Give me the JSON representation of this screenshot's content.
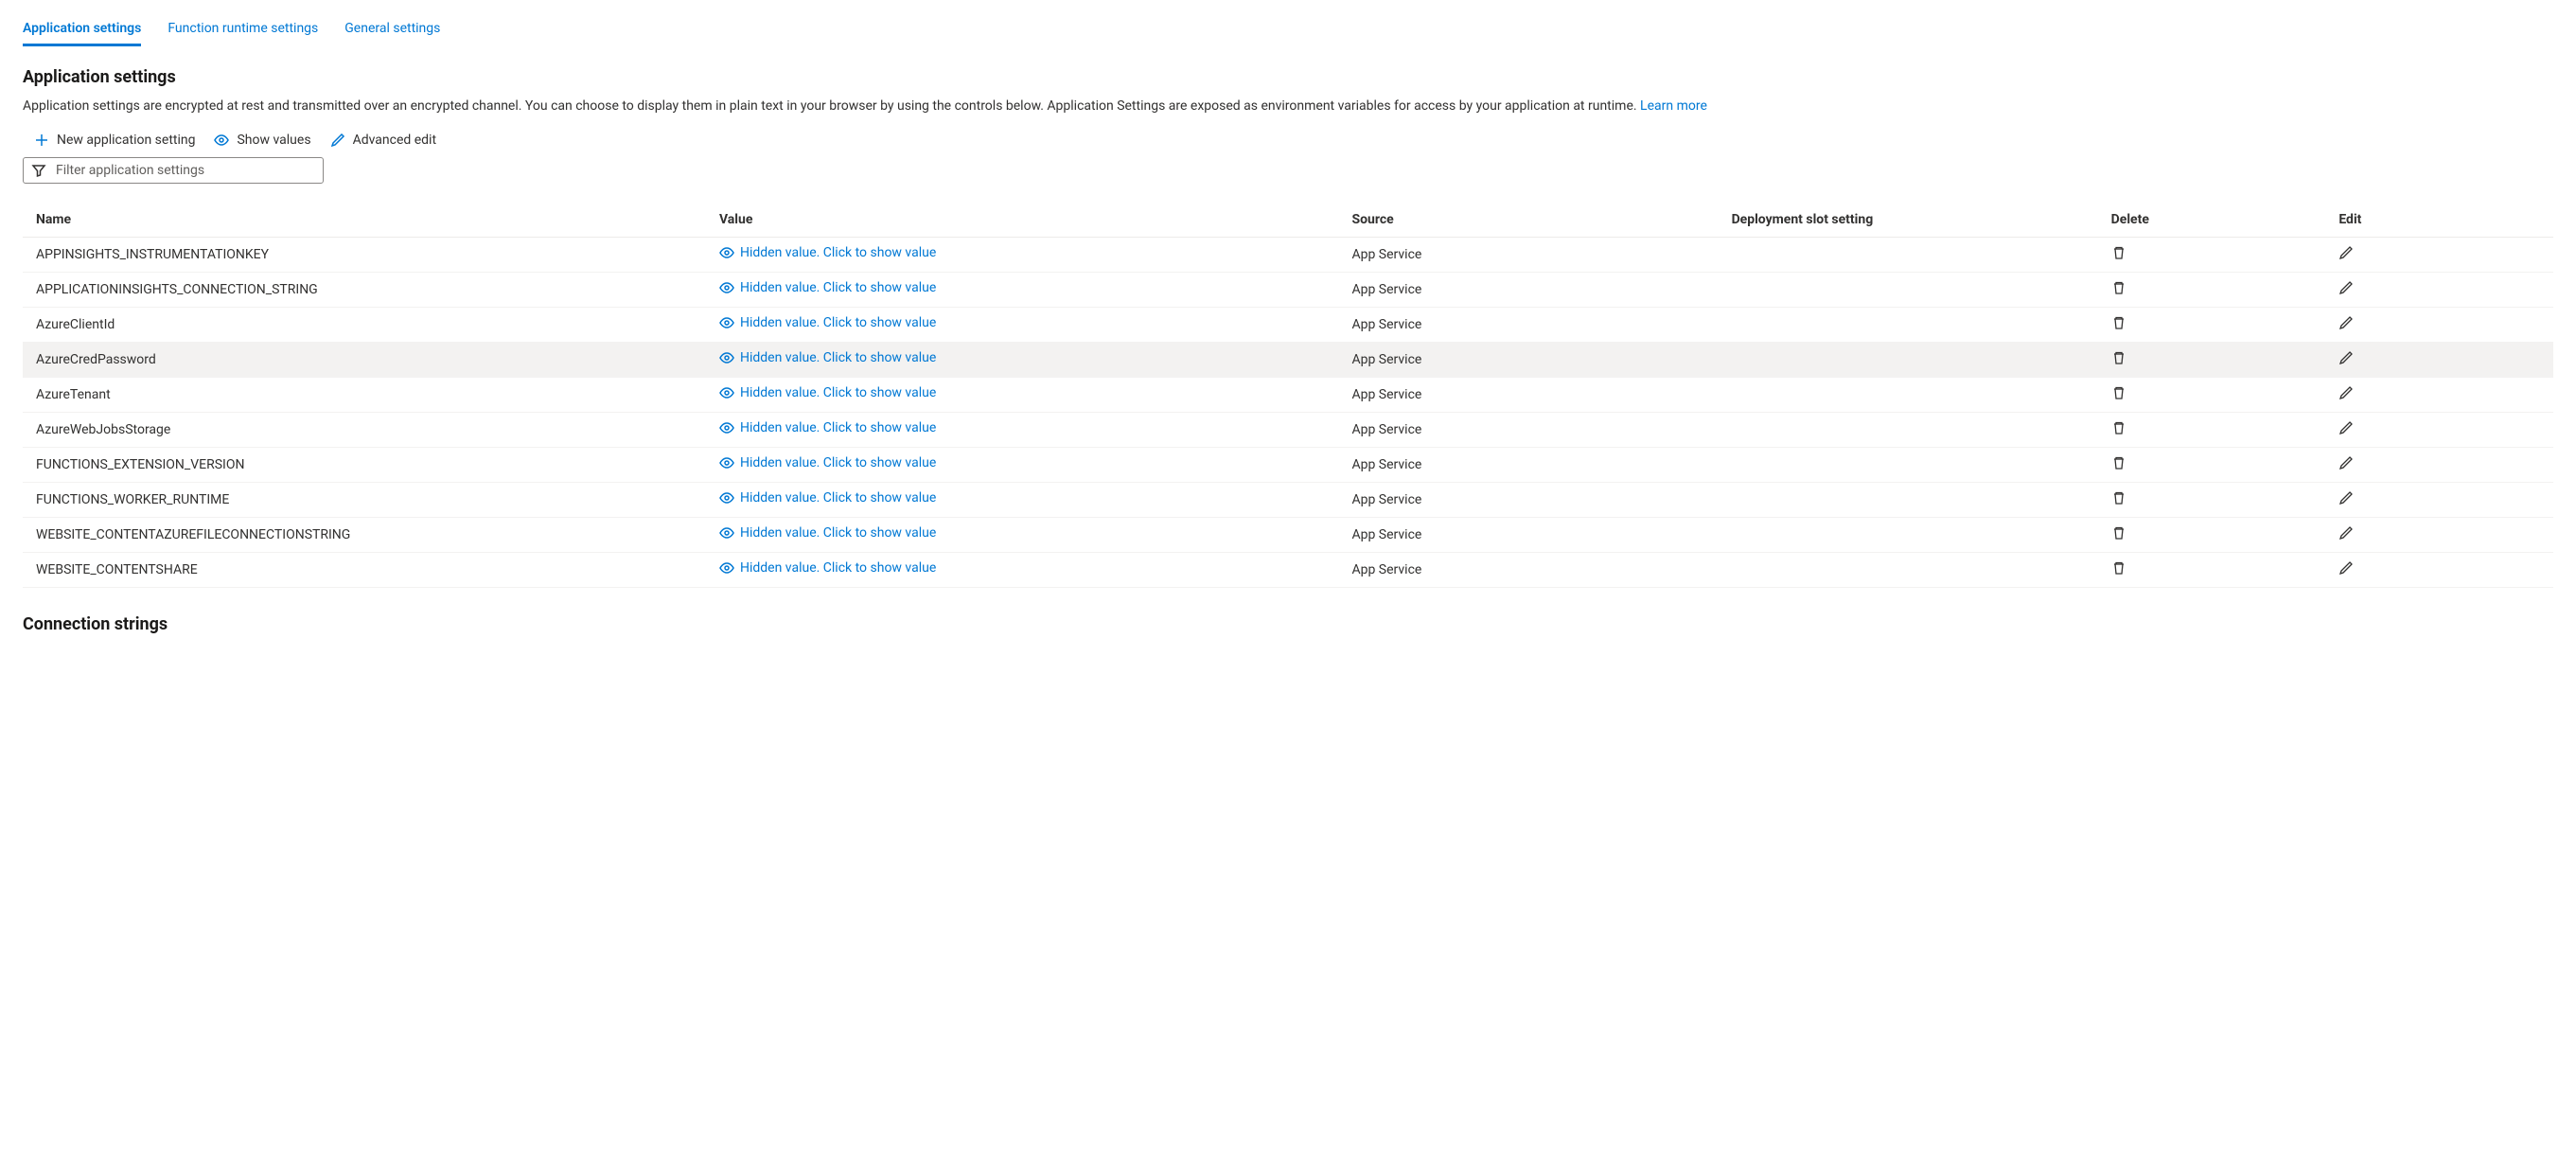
{
  "tabs": {
    "app": "Application settings",
    "runtime": "Function runtime settings",
    "general": "General settings"
  },
  "section": {
    "title": "Application settings",
    "description": "Application settings are encrypted at rest and transmitted over an encrypted channel. You can choose to display them in plain text in your browser by using the controls below. Application Settings are exposed as environment variables for access by your application at runtime. ",
    "learn_more": "Learn more"
  },
  "toolbar": {
    "new": "New application setting",
    "show": "Show values",
    "advanced": "Advanced edit"
  },
  "filter": {
    "placeholder": "Filter application settings"
  },
  "table": {
    "headers": {
      "name": "Name",
      "value": "Value",
      "source": "Source",
      "deploy": "Deployment slot setting",
      "delete": "Delete",
      "edit": "Edit"
    },
    "hidden_label": "Hidden value. Click to show value",
    "source_label": "App Service",
    "rows": [
      {
        "name": "APPINSIGHTS_INSTRUMENTATIONKEY",
        "highlight": false
      },
      {
        "name": "APPLICATIONINSIGHTS_CONNECTION_STRING",
        "highlight": false
      },
      {
        "name": "AzureClientId",
        "highlight": false
      },
      {
        "name": "AzureCredPassword",
        "highlight": true
      },
      {
        "name": "AzureTenant",
        "highlight": false
      },
      {
        "name": "AzureWebJobsStorage",
        "highlight": false
      },
      {
        "name": "FUNCTIONS_EXTENSION_VERSION",
        "highlight": false
      },
      {
        "name": "FUNCTIONS_WORKER_RUNTIME",
        "highlight": false
      },
      {
        "name": "WEBSITE_CONTENTAZUREFILECONNECTIONSTRING",
        "highlight": false
      },
      {
        "name": "WEBSITE_CONTENTSHARE",
        "highlight": false
      }
    ]
  },
  "connection": {
    "title": "Connection strings"
  }
}
